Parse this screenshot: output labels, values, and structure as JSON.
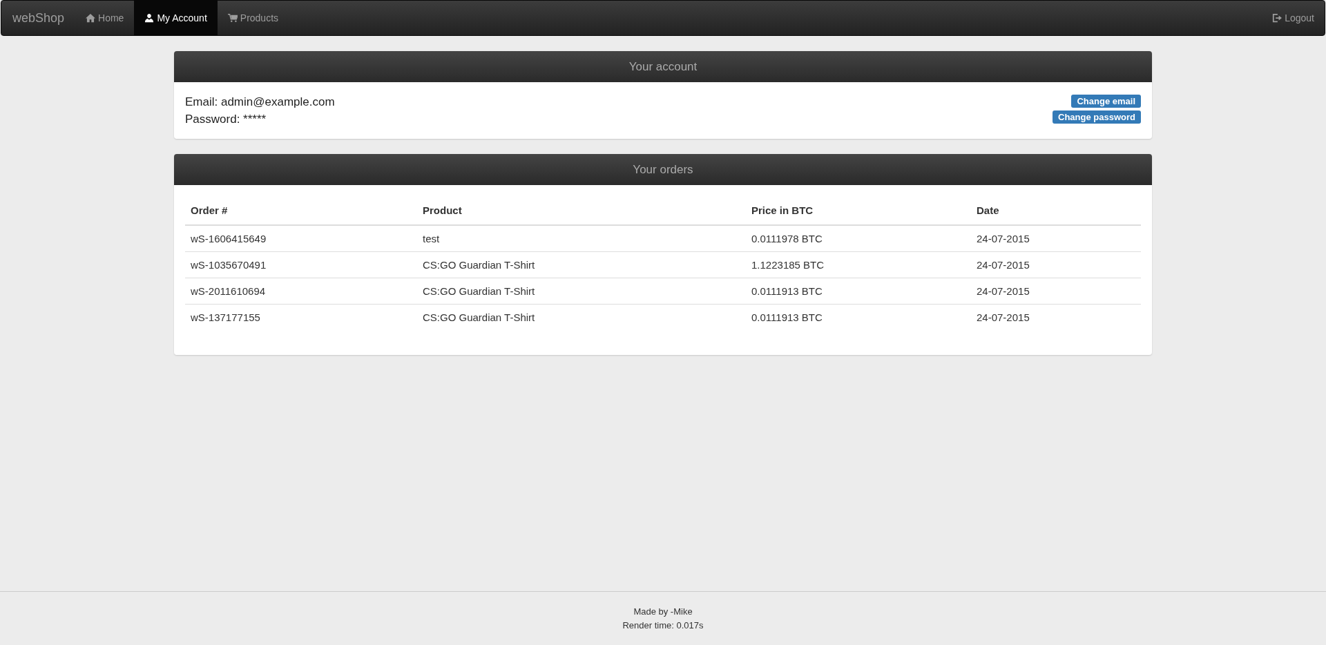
{
  "navbar": {
    "brand": "webShop",
    "items": [
      {
        "label": "Home",
        "kind": "home",
        "selected": false
      },
      {
        "label": "My Account",
        "kind": "user",
        "selected": true
      },
      {
        "label": "Products",
        "kind": "cart",
        "selected": false
      }
    ],
    "logout": "Logout"
  },
  "account": {
    "title": "Your account",
    "email_label": "Email: admin@example.com",
    "password_label": "Password: *****",
    "buttons": [
      "Change email",
      "Change password"
    ]
  },
  "orders": {
    "title": "Your orders",
    "columns": [
      "Order #",
      "Product",
      "Price in BTC",
      "Date"
    ],
    "rows": [
      [
        "wS-1606415649",
        "test",
        "0.0111978 BTC",
        "24-07-2015"
      ],
      [
        "wS-1035670491",
        "CS:GO Guardian T-Shirt",
        "1.1223185 BTC",
        "24-07-2015"
      ],
      [
        "wS-2011610694",
        "CS:GO Guardian T-Shirt",
        "0.0111913 BTC",
        "24-07-2015"
      ],
      [
        "wS-137177155",
        "CS:GO Guardian T-Shirt",
        "0.0111913 BTC",
        "24-07-2015"
      ]
    ]
  },
  "footer": {
    "lines": [
      "Made by -Mike",
      "Render time: 0.017s"
    ]
  }
}
